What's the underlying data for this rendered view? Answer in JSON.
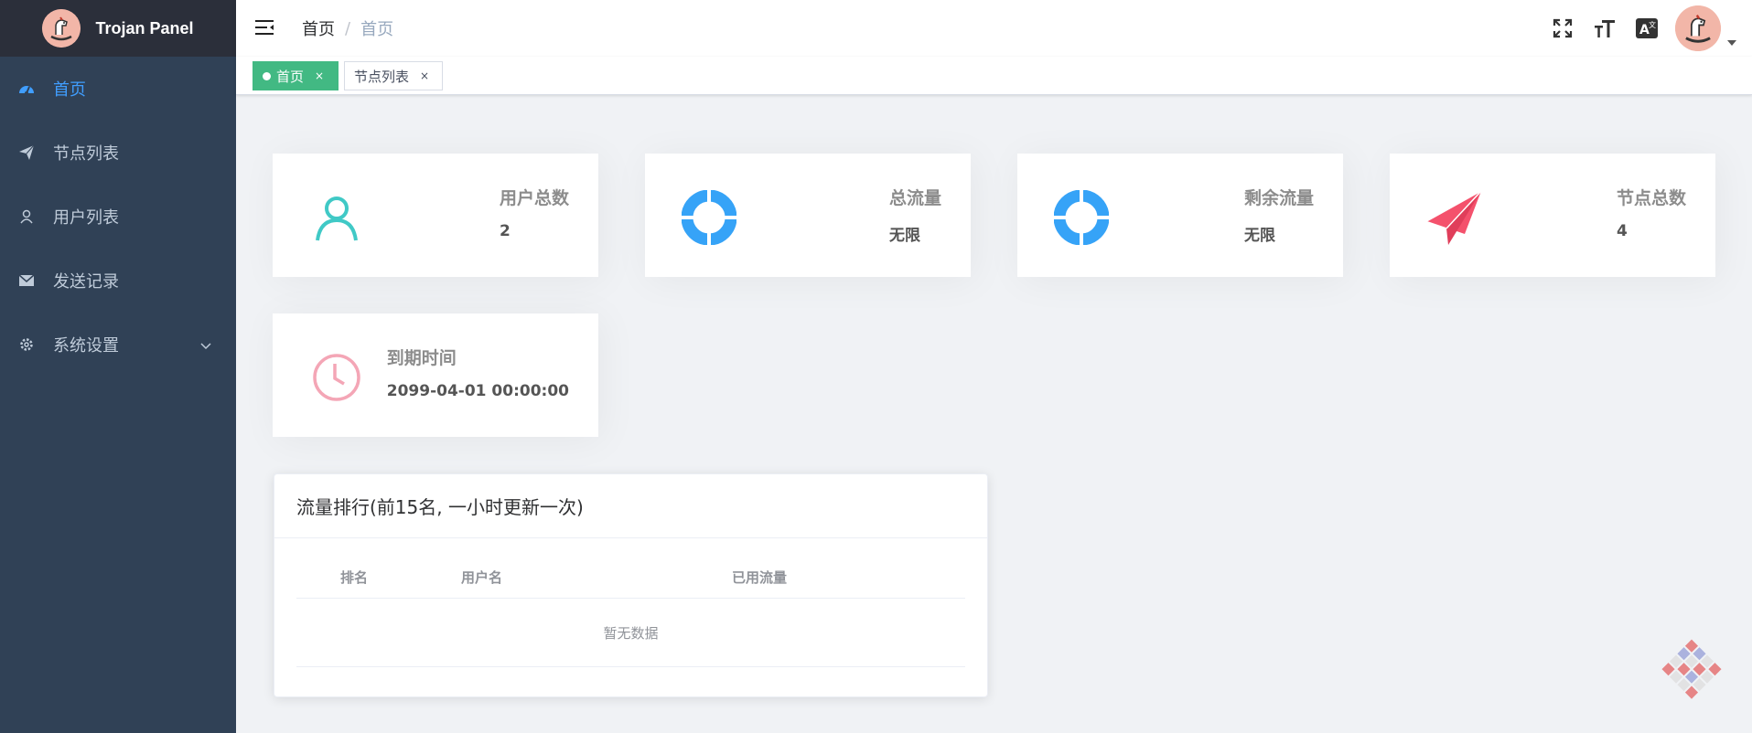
{
  "app": {
    "title": "Trojan Panel"
  },
  "sidebar": {
    "items": [
      {
        "label": "首页",
        "icon": "dashboard-icon",
        "active": true
      },
      {
        "label": "节点列表",
        "icon": "paper-plane-icon"
      },
      {
        "label": "用户列表",
        "icon": "user-icon"
      },
      {
        "label": "发送记录",
        "icon": "envelope-icon"
      },
      {
        "label": "系统设置",
        "icon": "gear-icon",
        "has_submenu": true
      }
    ]
  },
  "header": {
    "breadcrumb": [
      "首页",
      "首页"
    ],
    "separator": "/",
    "icons": [
      "fullscreen-icon",
      "font-size-icon",
      "language-icon",
      "avatar",
      "caret-down-icon"
    ]
  },
  "tags": [
    {
      "label": "首页",
      "active": true,
      "close": "×"
    },
    {
      "label": "节点列表",
      "active": false,
      "close": "×"
    }
  ],
  "stats": {
    "users": {
      "title": "用户总数",
      "value": "2",
      "color": "#40c9c6"
    },
    "total_traffic": {
      "title": "总流量",
      "value": "无限",
      "color": "#36a3f7"
    },
    "remaining_traffic": {
      "title": "剩余流量",
      "value": "无限",
      "color": "#36a3f7"
    },
    "nodes": {
      "title": "节点总数",
      "value": "4",
      "color": "#f4516c"
    },
    "expiry": {
      "title": "到期时间",
      "value": "2099-04-01 00:00:00",
      "color": "#f4a6b6"
    }
  },
  "ranking": {
    "title": "流量排行(前15名, 一小时更新一次)",
    "columns": [
      "排名",
      "用户名",
      "已用流量"
    ],
    "rows": [],
    "empty_text": "暂无数据"
  },
  "colors": {
    "sidebar_bg": "#304156",
    "logo_bg": "#2b2f3a",
    "active_menu": "#409eff",
    "tag_active": "#42b983",
    "page_bg": "#f0f2f5"
  }
}
